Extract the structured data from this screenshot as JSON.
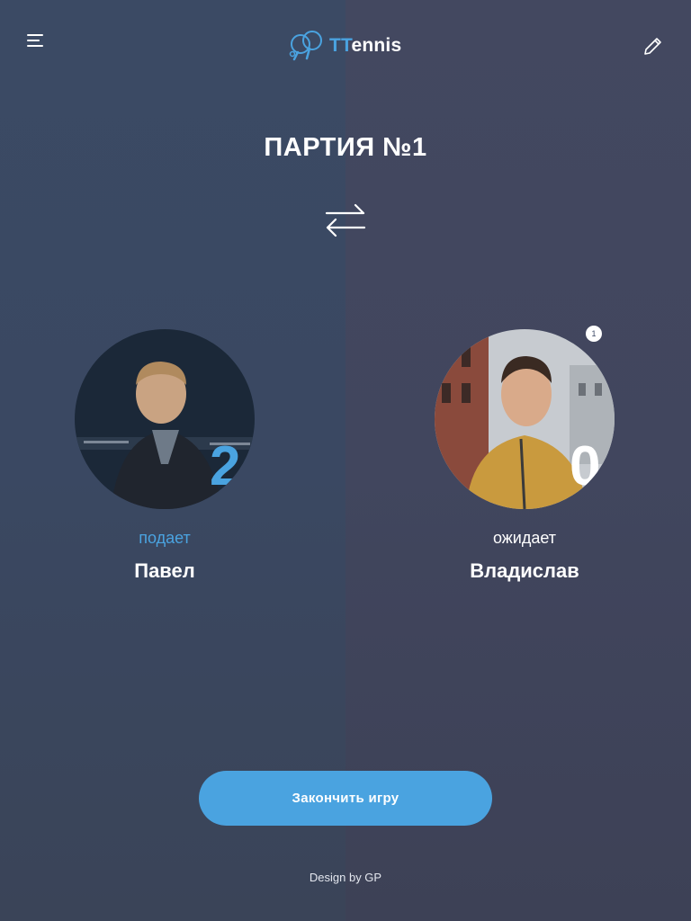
{
  "app": {
    "logo_accent": "TT",
    "logo_rest": "ennis",
    "accent_color": "#4aa3e0"
  },
  "header": {
    "menu_icon": "hamburger-menu-icon",
    "edit_icon": "pencil-icon"
  },
  "match": {
    "title": "ПАРТИЯ №1",
    "swap_icon": "swap-arrows-icon"
  },
  "players": [
    {
      "name": "Павел",
      "status": "подает",
      "score": "2",
      "badge": ""
    },
    {
      "name": "Владислав",
      "status": "ожидает",
      "score": "0",
      "badge": "1"
    }
  ],
  "actions": {
    "finish_label": "Закончить игру"
  },
  "footer": {
    "credit": "Design by GP"
  }
}
